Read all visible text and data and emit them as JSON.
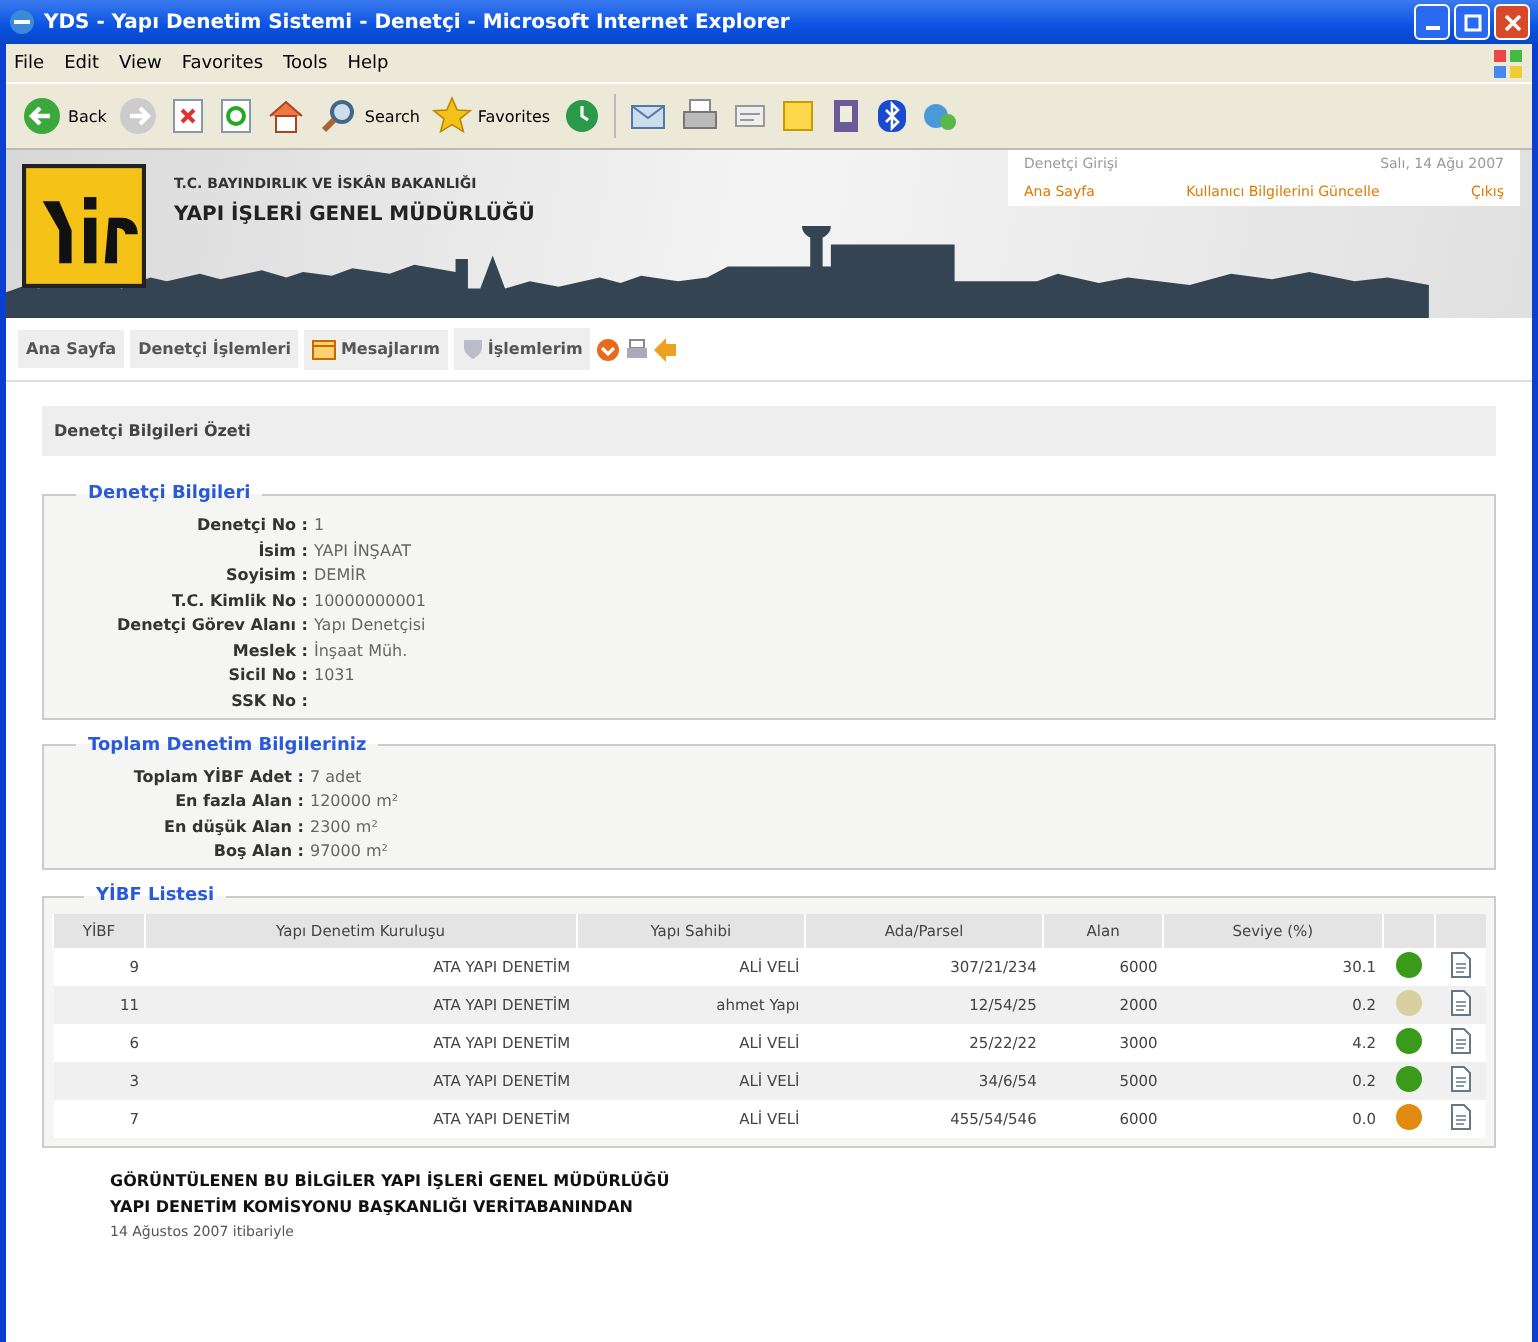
{
  "window": {
    "title": "YDS - Yapı Denetim Sistemi - Denetçi - Microsoft Internet Explorer"
  },
  "menu": [
    "File",
    "Edit",
    "View",
    "Favorites",
    "Tools",
    "Help"
  ],
  "toolbar": [
    {
      "kind": "back",
      "label": "Back"
    },
    {
      "kind": "search",
      "label": "Search"
    },
    {
      "kind": "favorites",
      "label": "Favorites"
    }
  ],
  "banner": {
    "ministry": "T.C. BAYINDIRLIK VE İSKÂN BAKANLIĞI",
    "org": "YAPI İŞLERİ GENEL MÜDÜRLÜĞÜ",
    "user": "Denetçi Girişi",
    "date": "Salı, 14 Ağu 2007",
    "links": [
      "Ana Sayfa",
      "Kullanıcı Bilgilerini Güncelle",
      "Çıkış"
    ]
  },
  "nav": [
    {
      "label": "Ana Sayfa",
      "kind": "text"
    },
    {
      "label": "Denetçi İşlemleri",
      "kind": "text"
    },
    {
      "label": "Mesajlarım",
      "kind": "mail"
    },
    {
      "label": "İşlemlerim",
      "kind": "shield"
    }
  ],
  "summary_title": "Denetçi Bilgileri Özeti",
  "sections": [
    {
      "title": "Denetçi Bilgileri",
      "fields": [
        {
          "label": "Denetçi No :",
          "value": "1"
        },
        {
          "label": "İsim :",
          "value": "YAPI İNŞAAT"
        },
        {
          "label": "Soyisim :",
          "value": "DEMİR"
        },
        {
          "label": "T.C. Kimlik No :",
          "value": "10000000001"
        },
        {
          "label": "Denetçi Görev Alanı :",
          "value": "Yapı Denetçisi"
        },
        {
          "label": "Meslek :",
          "value": "İnşaat Müh."
        },
        {
          "label": "Sicil No :",
          "value": "1031"
        },
        {
          "label": "SSK No :"
        }
      ]
    },
    {
      "title": "Toplam Denetim Bilgileriniz",
      "fields": [
        {
          "label": "Toplam YİBF Adet :",
          "value": "7 adet"
        },
        {
          "label": "En fazla Alan :",
          "value": "120000 m²"
        },
        {
          "label": "En düşük Alan :",
          "value": "2300 m²"
        },
        {
          "label": "Boş Alan :",
          "value": "97000 m²"
        }
      ]
    }
  ],
  "list": {
    "title": "YİBF Listesi",
    "columns": [
      "YİBF",
      "Yapı Denetim Kuruluşu",
      "Yapı Sahibi",
      "Ada/Parsel",
      "Alan",
      "Seviye (%)"
    ],
    "rows": [
      {
        "cells": [
          "9",
          "ATA YAPI DENETİM",
          "ALİ VELİ",
          "307/21/234",
          "6000",
          "30.1"
        ],
        "color": "#3a9a1a"
      },
      {
        "cells": [
          "11",
          "ATA YAPI DENETİM",
          "ahmet Yapı",
          "12/54/25",
          "2000",
          "0.2"
        ],
        "color": "#d8d0a0"
      },
      {
        "cells": [
          "6",
          "ATA YAPI DENETİM",
          "ALİ VELİ",
          "25/22/22",
          "3000",
          "4.2"
        ],
        "color": "#3a9a1a"
      },
      {
        "cells": [
          "3",
          "ATA YAPI DENETİM",
          "ALİ VELİ",
          "34/6/54",
          "5000",
          "0.2"
        ],
        "color": "#3a9a1a"
      },
      {
        "cells": [
          "7",
          "ATA YAPI DENETİM",
          "ALİ VELİ",
          "455/54/546",
          "6000",
          "0.0"
        ],
        "color": "#e08a10"
      }
    ]
  },
  "footer": [
    "GÖRÜNTÜLENEN BU BİLGİLER YAPI İŞLERİ GENEL MÜDÜRLÜĞÜ",
    "YAPI DENETİM KOMİSYONU BAŞKANLIĞI VERİTABANINDAN",
    "14 Ağustos 2007 itibariyle"
  ]
}
